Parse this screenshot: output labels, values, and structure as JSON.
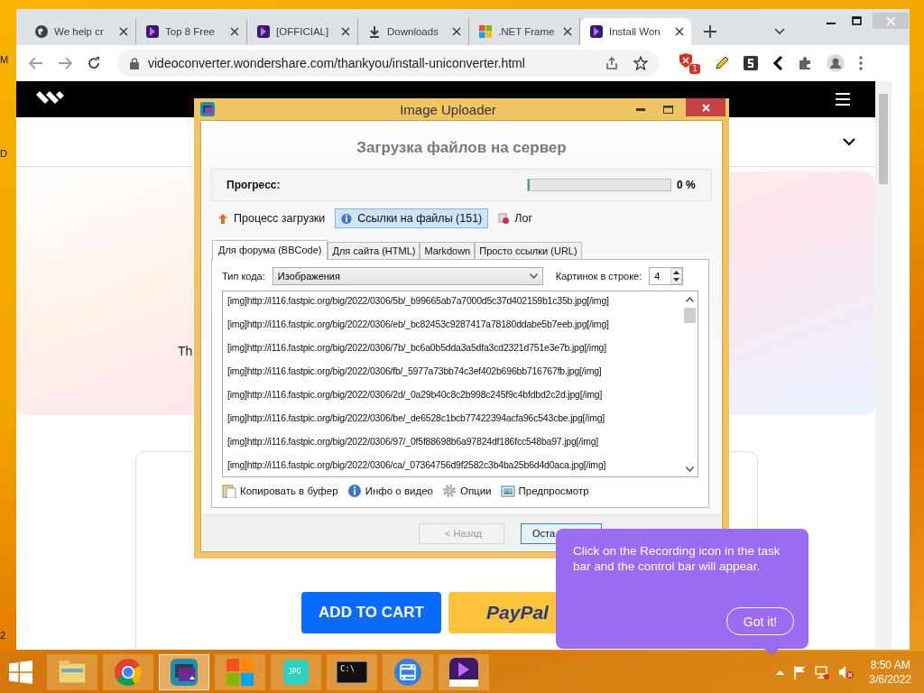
{
  "desktop": {
    "icon_labels": [
      "M",
      "D",
      "2"
    ]
  },
  "browser": {
    "tabs": [
      {
        "title": "We help cr",
        "kind": "globe",
        "selected": false
      },
      {
        "title": "Top 8 Free",
        "kind": "brand",
        "selected": false
      },
      {
        "title": "[OFFICIAL]",
        "kind": "brand",
        "selected": false
      },
      {
        "title": "Downloads",
        "kind": "download",
        "selected": false
      },
      {
        "title": ".NET Frame",
        "kind": "windows",
        "selected": false
      },
      {
        "title": "Install Won",
        "kind": "brand",
        "selected": true
      }
    ],
    "url": "videoconverter.wondershare.com/thankyou/install-uniconverter.html",
    "extension_badge": "1"
  },
  "page": {
    "text_fragment": "Th",
    "buttons": [
      {
        "label": "ADD TO CART",
        "kind": "cart"
      },
      {
        "label": "PayPal",
        "kind": "paypal"
      }
    ]
  },
  "dialog": {
    "title": "Image Uploader",
    "heading": "Загрузка файлов на сервер",
    "progress": {
      "label": "Прогресс:",
      "level": 0,
      "reading": "0 %"
    },
    "views": [
      {
        "label": "Процесс загрузки",
        "kind": "upload",
        "selected": false
      },
      {
        "label": "Ссылки на файлы (151)",
        "kind": "links",
        "selected": true
      },
      {
        "label": "Лог",
        "kind": "log",
        "selected": false
      }
    ],
    "tabs": [
      {
        "label": "Для форума (BBCode)",
        "selected": true
      },
      {
        "label": "Для сайта (HTML)",
        "selected": false
      },
      {
        "label": "Markdown",
        "selected": false
      },
      {
        "label": "Просто ссылки (URL)",
        "selected": false
      }
    ],
    "code_type": {
      "label": "Тип кода:",
      "value": "Изображения"
    },
    "per_row": {
      "label": "Картинок в строке:",
      "value": "4"
    },
    "links": [
      "[img]http://i116.fastpic.org/big/2022/0306/5b/_b99665ab7a7000d5c37d402159b1c35b.jpg[/img]",
      "[img]http://i116.fastpic.org/big/2022/0306/eb/_bc82453c9287417a78180ddabe5b7eeb.jpg[/img]",
      "[img]http://i116.fastpic.org/big/2022/0306/7b/_bc6a0b5dda3a5dfa3cd2321d751e3e7b.jpg[/img]",
      "[img]http://i116.fastpic.org/big/2022/0306/fb/_5977a73bb74c3ef402b696bb716767fb.jpg[/img]",
      "[img]http://i116.fastpic.org/big/2022/0306/2d/_0a29b40c8c2b998c245f9c4bfdbd2c2d.jpg[/img]",
      "[img]http://i116.fastpic.org/big/2022/0306/be/_de6528c1bcb77422394acfa96c543cbe.jpg[/img]",
      "[img]http://i116.fastpic.org/big/2022/0306/97/_0f5f88698b6a97824df186fcc548ba97.jpg[/img]",
      "[img]http://i116.fastpic.org/big/2022/0306/ca/_07364756d9f2582c3b4ba25b6d4d0aca.jpg[/img]"
    ],
    "actions": [
      {
        "label": "Копировать в буфер",
        "kind": "clipboard"
      },
      {
        "label": "Инфо о видео",
        "kind": "info"
      },
      {
        "label": "Опции",
        "kind": "gear"
      },
      {
        "label": "Предпросмотр",
        "kind": "picture"
      }
    ],
    "buttons": [
      {
        "label": "< Назад",
        "disabled": true
      },
      {
        "label": "Оста",
        "disabled": false
      }
    ]
  },
  "tooltip": {
    "text": "Click on the Recording icon in the task bar and the control bar will appear.",
    "button": "Got it!"
  },
  "taskbar": {
    "apps": [
      {
        "kind": "folder",
        "selected": false
      },
      {
        "kind": "chrome",
        "selected": false
      },
      {
        "kind": "uploader",
        "selected": true
      },
      {
        "kind": "tiles",
        "selected": false
      },
      {
        "kind": "jpg",
        "label": "JPG",
        "selected": false
      },
      {
        "kind": "terminal",
        "label": "C:\\",
        "selected": false
      },
      {
        "kind": "sync",
        "selected": false
      },
      {
        "kind": "converter",
        "selected": false
      }
    ],
    "time": "8:50 AM",
    "date": "3/6/2022"
  }
}
